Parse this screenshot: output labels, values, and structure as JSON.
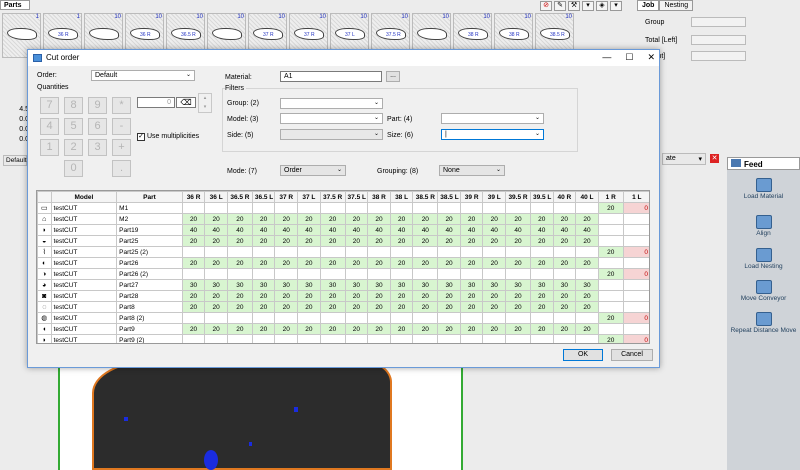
{
  "background": {
    "parts_label": "Parts",
    "tabs": [
      "Job",
      "Nesting"
    ],
    "thumbs": [
      {
        "n": "1",
        "label": ""
      },
      {
        "n": "1",
        "label": "36 R"
      },
      {
        "n": "10",
        "label": ""
      },
      {
        "n": "10",
        "label": "36 R"
      },
      {
        "n": "10",
        "label": "36.5 R"
      },
      {
        "n": "10",
        "label": ""
      },
      {
        "n": "10",
        "label": "37 R"
      },
      {
        "n": "10",
        "label": "37 R"
      },
      {
        "n": "10",
        "label": "37 L"
      },
      {
        "n": "10",
        "label": "37.5 R"
      },
      {
        "n": "10",
        "label": ""
      },
      {
        "n": "10",
        "label": "38 R"
      },
      {
        "n": "10",
        "label": "38 R"
      },
      {
        "n": "10",
        "label": "38.5 R"
      }
    ],
    "left_values": [
      "4.5",
      "0.0",
      "0.0",
      "0.0"
    ],
    "default_label": "Default",
    "right_fields": [
      {
        "label": "Group"
      },
      {
        "label": "Total [Left]"
      },
      {
        "label": "[Right]"
      }
    ],
    "order_combo_value": "ate",
    "feed": "Feed",
    "feed_items": [
      "Load Material",
      "Align",
      "Load Nesting",
      "Move Conveyor",
      "Repeat Distance Move"
    ]
  },
  "dialog": {
    "title": "Cut order",
    "order_label": "Order:",
    "order_value": "Default",
    "quantities_label": "Quantities",
    "qty_value": "0",
    "keypad": [
      "7",
      "8",
      "9",
      "*",
      "4",
      "5",
      "6",
      "-",
      "1",
      "2",
      "3",
      "+",
      "0",
      "."
    ],
    "use_multiplicities": "Use multiplicities",
    "material_label": "Material:",
    "material_value": "A1",
    "browse": "...",
    "filters_label": "Filters",
    "group_label": "Group: (2)",
    "model_label": "Model: (3)",
    "part_label": "Part: (4)",
    "side_label": "Side: (5)",
    "size_label": "Size: (6)",
    "mode_label": "Mode: (7)",
    "mode_value": "Order",
    "grouping_label": "Grouping: (8)",
    "grouping_value": "None",
    "ok": "OK",
    "cancel": "Cancel",
    "columns": [
      "",
      "Model",
      "Part",
      "36 R",
      "36 L",
      "36.5 R",
      "36.5 L",
      "37 R",
      "37 L",
      "37.5 R",
      "37.5 L",
      "38 R",
      "38 L",
      "38.5 R",
      "38.5 L",
      "39 R",
      "39 L",
      "39.5 R",
      "39.5 L",
      "40 R",
      "40 L",
      "1 R",
      "1 L"
    ],
    "rows": [
      {
        "icon": "▭",
        "model": "testCUT",
        "part": "M1",
        "t": "one"
      },
      {
        "icon": "⌂",
        "model": "testCUT",
        "part": "M2",
        "t": "sz",
        "v": "20"
      },
      {
        "icon": "◗",
        "model": "testCUT",
        "part": "Part19",
        "t": "sz",
        "v": "40"
      },
      {
        "icon": "◒",
        "model": "testCUT",
        "part": "Part25",
        "t": "sz",
        "v": "20"
      },
      {
        "icon": "⌇",
        "model": "testCUT",
        "part": "Part25 (2)",
        "t": "one"
      },
      {
        "icon": "◐",
        "model": "testCUT",
        "part": "Part26",
        "t": "sz",
        "v": "20"
      },
      {
        "icon": "◑",
        "model": "testCUT",
        "part": "Part26 (2)",
        "t": "one"
      },
      {
        "icon": "◕",
        "model": "testCUT",
        "part": "Part27",
        "t": "sz",
        "v": "30"
      },
      {
        "icon": "◙",
        "model": "testCUT",
        "part": "Part28",
        "t": "sz",
        "v": "20"
      },
      {
        "icon": "◌",
        "model": "testCUT",
        "part": "Part8",
        "t": "sz",
        "v": "20"
      },
      {
        "icon": "◍",
        "model": "testCUT",
        "part": "Part8 (2)",
        "t": "one"
      },
      {
        "icon": "◖",
        "model": "testCUT",
        "part": "Part9",
        "t": "sz",
        "v": "20"
      },
      {
        "icon": "◗",
        "model": "testCUT",
        "part": "Part9 (2)",
        "t": "one"
      }
    ],
    "one_r": "20",
    "one_l": "0"
  }
}
